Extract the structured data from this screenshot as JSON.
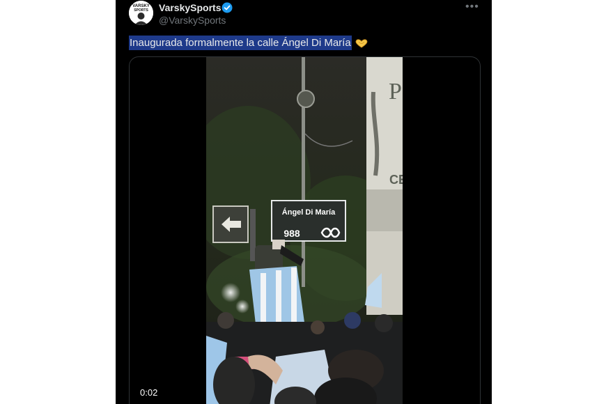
{
  "author": {
    "display_name": "VarskySports",
    "handle": "@VarskySports",
    "avatar_text": "VARSKY SPORTS",
    "verified_color": "#1d9bf0",
    "avatar": "avatar-icon"
  },
  "tweet": {
    "text": "Inaugurada formalmente la calle Ángel Di María",
    "emoji": "heart-hands-icon",
    "more_icon": "ellipsis-icon"
  },
  "media": {
    "duration": "0:02",
    "sign_text": "Ángel Di María",
    "sign_number": "988",
    "pillar_text": "CE"
  },
  "colors": {
    "background": "#000000",
    "text": "#e7e9ea",
    "muted": "#71767b",
    "highlight": "#1e3a8a"
  }
}
